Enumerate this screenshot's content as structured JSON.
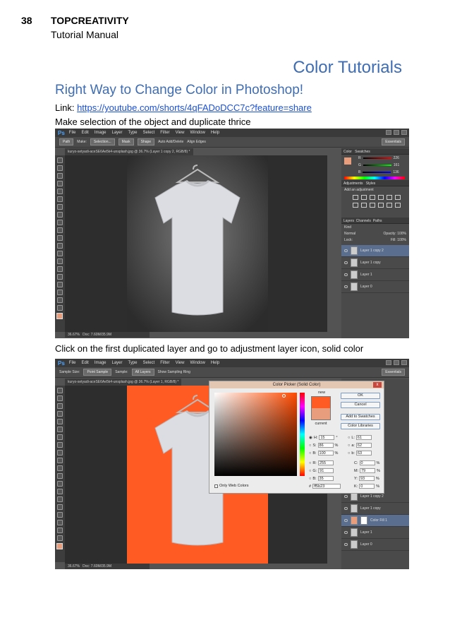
{
  "header": {
    "page_number": "38",
    "book_title": "TOPCREATIVITY",
    "subtitle": "Tutorial Manual"
  },
  "section_title": "Color Tutorials",
  "article_title": "Right Way to Change Color in Photoshop!",
  "link_label": "Link: ",
  "link_url": "https://youtube.com/shorts/4qFADoDCC7c?feature=share",
  "step1": "Make selection of the object and duplicate thrice",
  "step2": "Click on the first duplicated layer and go to adjustment layer icon, solid color",
  "ps": {
    "logo": "Ps",
    "menu": [
      "File",
      "Edit",
      "Image",
      "Layer",
      "Type",
      "Select",
      "Filter",
      "View",
      "Window",
      "Help"
    ],
    "essentials": "Essentials",
    "status_zoom": "36.67%",
    "status_doc": "Doc: 7.60M/35.9M",
    "swatch_color": "#e89e7d"
  },
  "shot1": {
    "options": [
      "Path",
      "Make:",
      "Selection...",
      "Mask",
      "Shape",
      "Auto Add/Delete",
      "Align Edges"
    ],
    "tab": "kuryo-setyadi-aceSE6Ae5k4-unsplash.jpg @ 36.7% (Layer 1 copy 2, RGB/8) *",
    "color_tab": "Color",
    "swatches_tab": "Swatches",
    "rgb": [
      {
        "label": "R",
        "value": "226"
      },
      {
        "label": "G",
        "value": "161"
      },
      {
        "label": "B",
        "value": "136"
      }
    ],
    "adjustments_tab": "Adjustments",
    "styles_tab": "Styles",
    "add_adjustment": "Add an adjustment",
    "layers_tabs": [
      "Layers",
      "Channels",
      "Paths"
    ],
    "kind": "Kind",
    "blend": "Normal",
    "opacity_label": "Opacity:",
    "opacity": "100%",
    "lock_label": "Lock:",
    "fill_label": "Fill:",
    "fill": "100%",
    "layers": [
      "Layer 1 copy 2",
      "Layer 1 copy",
      "Layer 1",
      "Layer 0"
    ]
  },
  "shot2": {
    "options": [
      "Sample Size:",
      "Point Sample",
      "Sample:",
      "All Layers",
      "Show Sampling Ring"
    ],
    "tab": "kuryo-setyadi-aceSE6Ae5k4-unsplash.jpg @ 36.7% (Layer 1, RGB/8) *",
    "layers": [
      "Layer 1 copy 2",
      "Layer 1 copy",
      "Color Fill 1",
      "Layer 1",
      "Layer 0"
    ],
    "fill_color": "#ff5b23"
  },
  "picker": {
    "title": "Color Picker (Solid Color)",
    "close": "x",
    "new_label": "new",
    "current_label": "current",
    "new_color": "#ff5b23",
    "current_color": "#e89e7d",
    "ok": "OK",
    "cancel": "Cancel",
    "add_swatches": "Add to Swatches",
    "libraries": "Color Libraries",
    "only_web": "Only Web Colors",
    "hash": "#",
    "hex": "ff5b23",
    "hsb": [
      {
        "label": "H:",
        "value": "15",
        "unit": "°"
      },
      {
        "label": "S:",
        "value": "86",
        "unit": "%"
      },
      {
        "label": "B:",
        "value": "100",
        "unit": "%"
      }
    ],
    "rgb": [
      {
        "label": "R:",
        "value": "255"
      },
      {
        "label": "G:",
        "value": "91"
      },
      {
        "label": "B:",
        "value": "35"
      }
    ],
    "lab": [
      {
        "label": "L:",
        "value": "61"
      },
      {
        "label": "a:",
        "value": "62"
      },
      {
        "label": "b:",
        "value": "63"
      }
    ],
    "cmyk": [
      {
        "label": "C:",
        "value": "0",
        "unit": "%"
      },
      {
        "label": "M:",
        "value": "79",
        "unit": "%"
      },
      {
        "label": "Y:",
        "value": "93",
        "unit": "%"
      },
      {
        "label": "K:",
        "value": "0",
        "unit": "%"
      }
    ]
  }
}
